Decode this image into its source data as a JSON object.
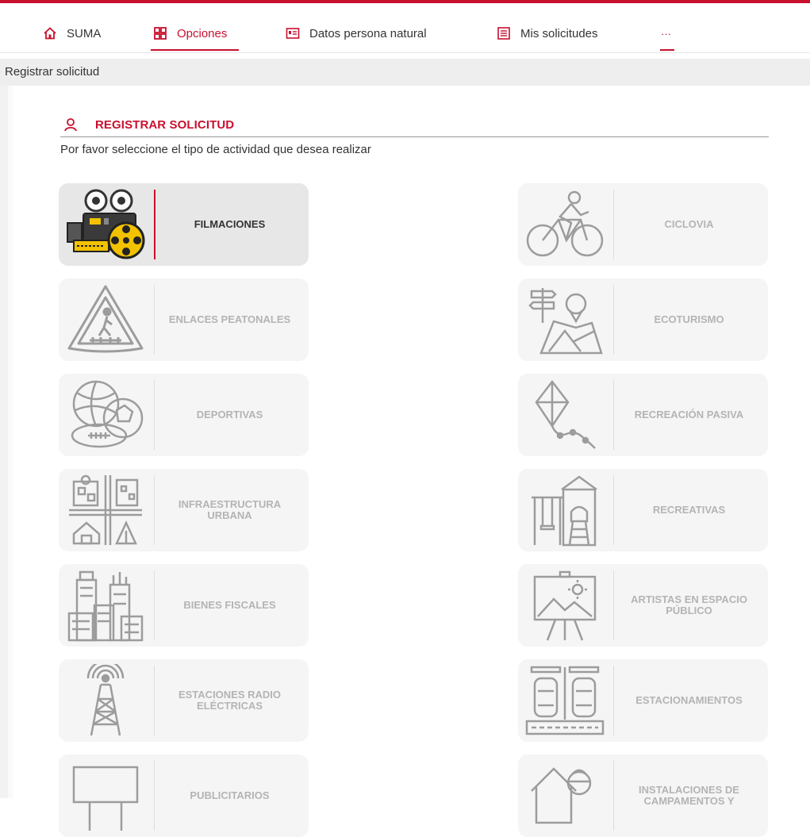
{
  "nav": {
    "items": [
      {
        "label": "SUMA",
        "icon": "home-icon"
      },
      {
        "label": "Opciones",
        "icon": "grid-icon",
        "active": true
      },
      {
        "label": "Datos persona natural",
        "icon": "id-card-icon"
      },
      {
        "label": "Mis solicitudes",
        "icon": "list-icon"
      },
      {
        "label": "···",
        "icon": "more-icon"
      }
    ]
  },
  "breadcrumb": "Registrar solicitud",
  "section": {
    "title": "REGISTRAR SOLICITUD",
    "subtitle": "Por favor seleccione el tipo de actividad que desea realizar"
  },
  "activities": [
    {
      "label": "FILMACIONES",
      "icon": "film-camera-icon"
    },
    {
      "label": "CICLOVIA",
      "icon": "bicycle-icon"
    },
    {
      "label": "ENLACES PEATONALES",
      "icon": "pedestrian-sign-icon"
    },
    {
      "label": "ECOTURISMO",
      "icon": "map-signpost-icon"
    },
    {
      "label": "DEPORTIVAS",
      "icon": "sports-balls-icon"
    },
    {
      "label": "RECREACIÓN PASIVA",
      "icon": "kite-icon"
    },
    {
      "label": "INFRAESTRUCTURA URBANA",
      "icon": "urban-infrastructure-icon"
    },
    {
      "label": "RECREATIVAS",
      "icon": "playground-icon"
    },
    {
      "label": "BIENES FISCALES",
      "icon": "buildings-icon"
    },
    {
      "label": "ARTISTAS EN ESPACIO PÚBLICO",
      "icon": "easel-icon"
    },
    {
      "label": "ESTACIONES RADIO ELÉCTRICAS",
      "icon": "radio-tower-icon"
    },
    {
      "label": "ESTACIONAMIENTOS",
      "icon": "parking-icon"
    },
    {
      "label": "PUBLICITARIOS",
      "icon": "billboard-icon"
    },
    {
      "label": "INSTALACIONES DE CAMPAMENTOS Y",
      "icon": "camp-worker-icon"
    }
  ],
  "colors": {
    "accent": "#c8102e",
    "card": "#f5f5f5",
    "card_active": "#e7e7e7",
    "film_yellow": "#f2c200"
  }
}
